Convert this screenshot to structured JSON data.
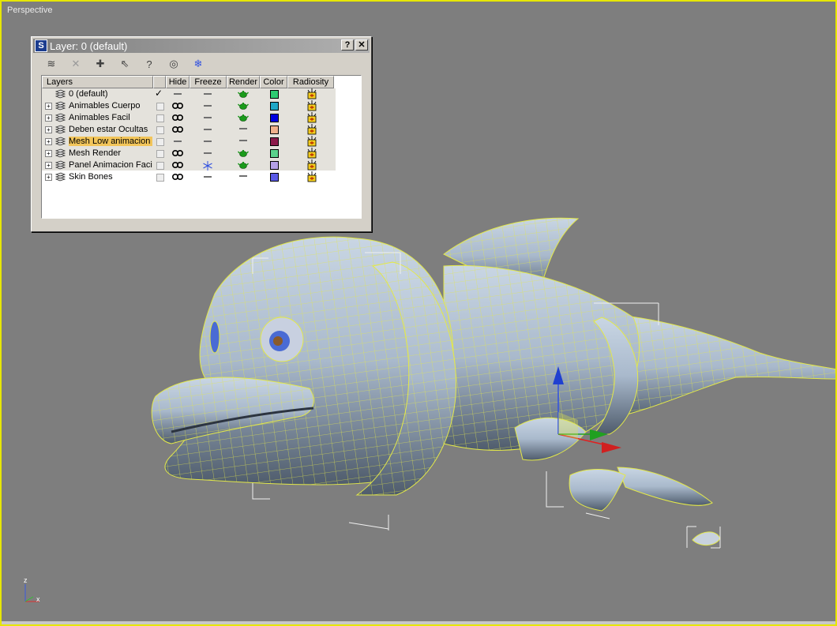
{
  "viewport": {
    "label": "Perspective",
    "axis_labels": {
      "z": "z",
      "x": "x"
    }
  },
  "dialog": {
    "title": "Layer: 0 (default)",
    "help_label": "?",
    "close_label": "✕",
    "toolbar": [
      {
        "name": "create-layer-icon",
        "glyph": "≋"
      },
      {
        "name": "delete-layer-icon",
        "glyph": "✕"
      },
      {
        "name": "add-selected-icon",
        "glyph": "✚"
      },
      {
        "name": "select-objects-icon",
        "glyph": "⇖"
      },
      {
        "name": "highlight-layer-icon",
        "glyph": "?"
      },
      {
        "name": "hide-all-icon",
        "glyph": "◎"
      },
      {
        "name": "freeze-all-icon",
        "glyph": "❄"
      }
    ],
    "columns": {
      "layers": "Layers",
      "hide": "Hide",
      "freeze": "Freeze",
      "render": "Render",
      "color": "Color",
      "radiosity": "Radiosity"
    },
    "layers": [
      {
        "name": "0 (default)",
        "expandable": false,
        "current": true,
        "hidden": false,
        "frozen": false,
        "renderable": true,
        "color": "#2ecc71",
        "selected": false
      },
      {
        "name": "Animables Cuerpo",
        "expandable": true,
        "current": false,
        "hidden": true,
        "frozen": false,
        "renderable": true,
        "color": "#1fa7c7",
        "selected": false
      },
      {
        "name": "Animables Facil",
        "expandable": true,
        "current": false,
        "hidden": true,
        "frozen": false,
        "renderable": true,
        "color": "#0000e0",
        "selected": false
      },
      {
        "name": "Deben estar Ocultas",
        "expandable": true,
        "current": false,
        "hidden": true,
        "frozen": false,
        "renderable": false,
        "color": "#f0b08c",
        "selected": false
      },
      {
        "name": "Mesh Low animacion",
        "expandable": true,
        "current": false,
        "hidden": false,
        "frozen": false,
        "renderable": false,
        "color": "#8c1a4a",
        "selected": true
      },
      {
        "name": "Mesh Render",
        "expandable": true,
        "current": false,
        "hidden": true,
        "frozen": false,
        "renderable": true,
        "color": "#5ad28c",
        "selected": false
      },
      {
        "name": "Panel Animacion Facial",
        "expandable": true,
        "current": false,
        "hidden": true,
        "frozen": true,
        "renderable": true,
        "color": "#b4a0e6",
        "selected": false
      },
      {
        "name": "Skin Bones",
        "expandable": true,
        "current": false,
        "hidden": true,
        "frozen": false,
        "renderable": false,
        "color": "#5a5ae6",
        "selected": false
      }
    ]
  }
}
